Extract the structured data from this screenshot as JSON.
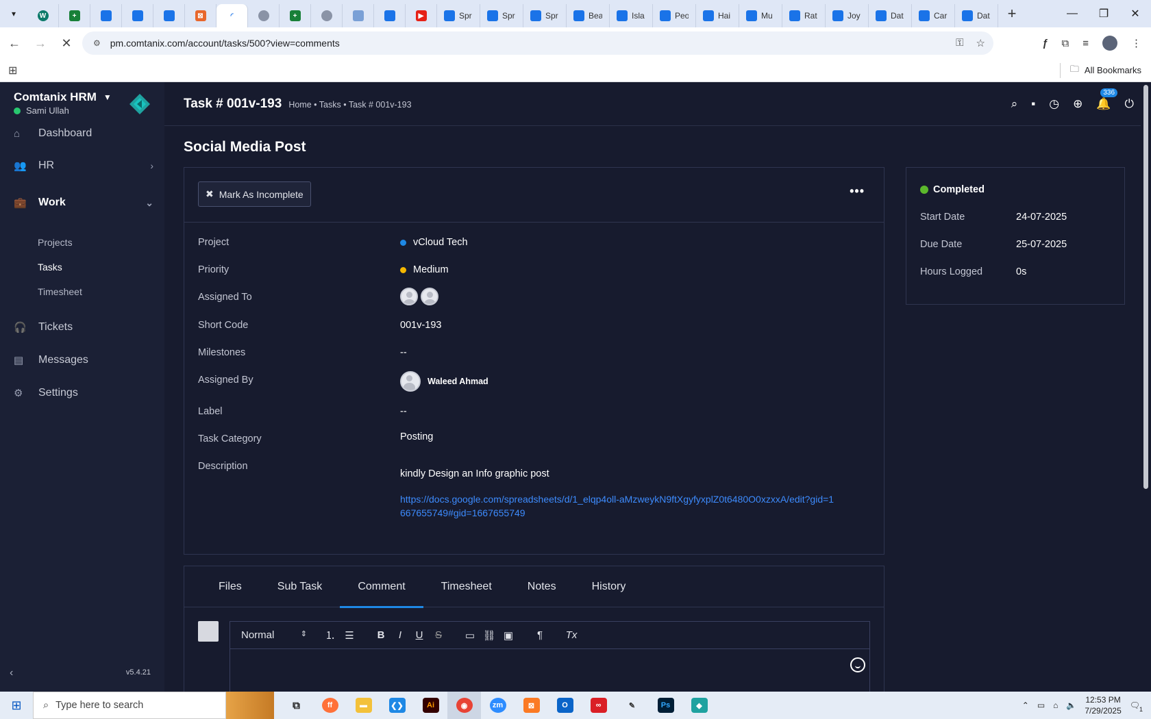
{
  "browser": {
    "tabs": [
      {
        "label": "",
        "icon": "wordpress-icon",
        "kind": "web"
      },
      {
        "label": "",
        "icon": "sheets-icon",
        "kind": "sheet"
      },
      {
        "label": "",
        "icon": "docs-icon",
        "kind": "doc"
      },
      {
        "label": "",
        "icon": "docs-icon",
        "kind": "doc"
      },
      {
        "label": "",
        "icon": "docs-icon",
        "kind": "doc"
      },
      {
        "label": "",
        "icon": "comtanix-icon",
        "kind": "red"
      },
      {
        "label": "",
        "icon": "loading-icon",
        "kind": "active"
      },
      {
        "label": "",
        "icon": "openai-icon",
        "kind": "gray"
      },
      {
        "label": "",
        "icon": "sheets-icon",
        "kind": "sheet"
      },
      {
        "label": "",
        "icon": "globe-icon",
        "kind": "gray"
      },
      {
        "label": "",
        "icon": "grid-icon",
        "kind": "grid"
      },
      {
        "label": "",
        "icon": "forms-icon",
        "kind": "doc"
      },
      {
        "label": "",
        "icon": "youtube-icon",
        "kind": "yt"
      },
      {
        "label": "Spr",
        "icon": "forms-icon",
        "kind": "doc"
      },
      {
        "label": "Spr",
        "icon": "forms-icon",
        "kind": "doc"
      },
      {
        "label": "Spr",
        "icon": "forms-icon",
        "kind": "doc"
      },
      {
        "label": "Bea",
        "icon": "forms-icon",
        "kind": "doc"
      },
      {
        "label": "Isla",
        "icon": "forms-icon",
        "kind": "doc"
      },
      {
        "label": "Peo",
        "icon": "forms-icon",
        "kind": "doc"
      },
      {
        "label": "Hai",
        "icon": "forms-icon",
        "kind": "doc"
      },
      {
        "label": "Mu",
        "icon": "forms-icon",
        "kind": "doc"
      },
      {
        "label": "Rat",
        "icon": "forms-icon",
        "kind": "doc"
      },
      {
        "label": "Joy",
        "icon": "forms-icon",
        "kind": "doc"
      },
      {
        "label": "Dat",
        "icon": "forms-icon",
        "kind": "doc"
      },
      {
        "label": "Car",
        "icon": "forms-icon",
        "kind": "doc"
      },
      {
        "label": "Dat",
        "icon": "forms-icon",
        "kind": "doc"
      }
    ],
    "url": "pm.comtanix.com/account/tasks/500?view=comments",
    "all_bookmarks": "All Bookmarks"
  },
  "sidebar": {
    "brand": "Comtanix HRM",
    "user": "Sami Ullah",
    "items": [
      {
        "label": "Dashboard",
        "icon": "home-icon"
      },
      {
        "label": "HR",
        "icon": "users-icon"
      },
      {
        "label": "Work",
        "icon": "briefcase-icon"
      },
      {
        "label": "Tickets",
        "icon": "headset-icon"
      },
      {
        "label": "Messages",
        "icon": "message-icon"
      },
      {
        "label": "Settings",
        "icon": "gear-icon"
      }
    ],
    "work_sub": [
      "Projects",
      "Tasks",
      "Timesheet"
    ],
    "version": "v5.4.21"
  },
  "header": {
    "title": "Task # 001v-193",
    "breadcrumb": "Home • Tasks • Task # 001v-193",
    "notification_count": "336"
  },
  "task": {
    "name": "Social Media Post",
    "mark_button": "Mark As Incomplete",
    "fields": {
      "project_label": "Project",
      "project_value": "vCloud Tech",
      "project_color": "#1e88e5",
      "priority_label": "Priority",
      "priority_value": "Medium",
      "priority_color": "#f5b700",
      "assigned_to_label": "Assigned To",
      "short_code_label": "Short Code",
      "short_code_value": "001v-193",
      "milestones_label": "Milestones",
      "milestones_value": "--",
      "assigned_by_label": "Assigned By",
      "assigned_by_value": "Waleed Ahmad",
      "label_label": "Label",
      "label_value": "--",
      "category_label": "Task Category",
      "category_value": "Posting",
      "description_label": "Description",
      "description_text": "kindly Design an Info graphic post",
      "description_link": "https://docs.google.com/spreadsheets/d/1_elqp4oll-aMzweykN9ftXgyfyxplZ0t6480O0xzxxA/edit?gid=1667655749#gid=1667655749"
    }
  },
  "status": {
    "state": "Completed",
    "state_color": "#5cb82c",
    "start_label": "Start Date",
    "start_value": "24-07-2025",
    "due_label": "Due Date",
    "due_value": "25-07-2025",
    "hours_label": "Hours Logged",
    "hours_value": "0s"
  },
  "tabs": [
    "Files",
    "Sub Task",
    "Comment",
    "Timesheet",
    "Notes",
    "History"
  ],
  "active_tab": "Comment",
  "editor": {
    "format": "Normal"
  },
  "taskbar": {
    "search_placeholder": "Type here to search",
    "time": "12:53 PM",
    "date": "7/29/2025",
    "notif_count": "1"
  }
}
